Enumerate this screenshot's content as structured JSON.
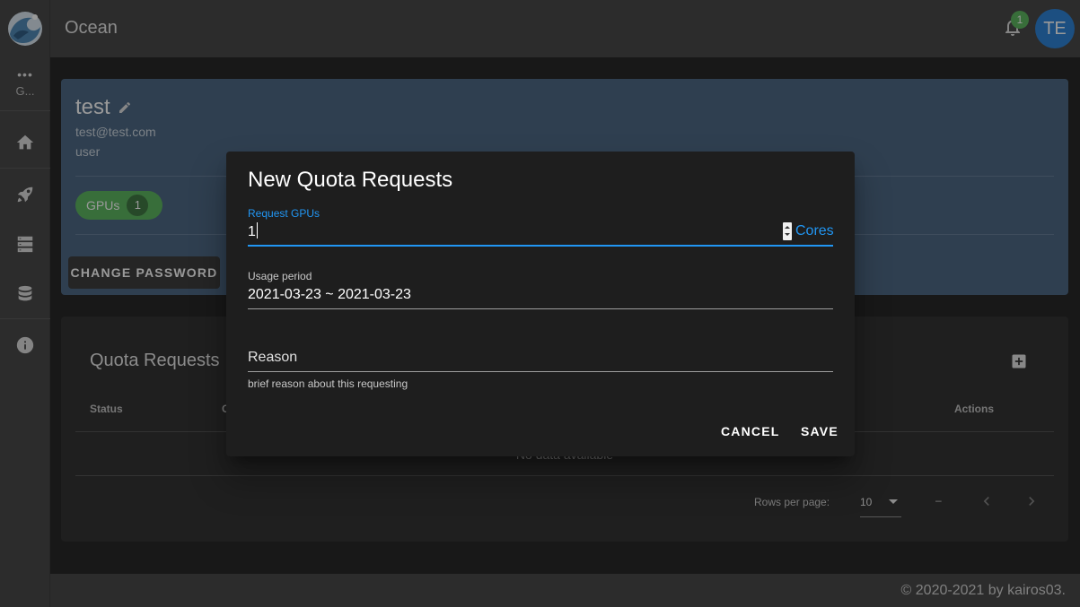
{
  "app": {
    "title": "Ocean"
  },
  "sidebar": {
    "more_label": "G...",
    "items": [
      {
        "icon": "home-icon"
      },
      {
        "icon": "rocket-icon"
      },
      {
        "icon": "server-icon"
      },
      {
        "icon": "database-icon"
      },
      {
        "icon": "info-icon"
      }
    ]
  },
  "header": {
    "notification_count": "1",
    "avatar_initials": "TE"
  },
  "profile": {
    "name": "test",
    "email": "test@test.com",
    "role": "user",
    "gpu_chip_label": "GPUs",
    "gpu_chip_count": "1",
    "change_password_label": "CHANGE PASSWORD"
  },
  "quota": {
    "title": "Quota Requests",
    "columns": [
      "Status",
      "C",
      "Actions"
    ],
    "no_data": "No data available",
    "rows_per_page_label": "Rows per page:",
    "rows_per_page_value": "10",
    "page_info": "–"
  },
  "dialog": {
    "title": "New Quota Requests",
    "gpu_label": "Request GPUs",
    "gpu_value": "1",
    "gpu_suffix": "Cores",
    "period_label": "Usage period",
    "period_value": "2021-03-23 ~ 2021-03-23",
    "reason_placeholder": "Reason",
    "reason_hint": "brief reason about this requesting",
    "cancel_label": "CANCEL",
    "save_label": "SAVE"
  },
  "footer": {
    "text": "© 2020-2021 by kairos03."
  },
  "colors": {
    "accent": "#2196f3",
    "chip": "#4caf50",
    "avatar": "#1976d2",
    "profile_bg": "#3c5a78"
  }
}
